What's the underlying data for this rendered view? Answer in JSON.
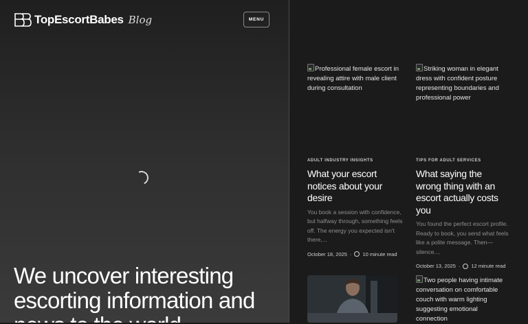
{
  "header": {
    "brand": "TopEscortBabes",
    "brand_suffix": "Blog",
    "menu_label": "MENU"
  },
  "hero": {
    "headline": "We uncover interesting escorting information and news to the world"
  },
  "posts": [
    {
      "image_alt": "Professional female escort in revealing attire with male client during consultation",
      "category": "ADULT INDUSTRY INSIGHTS",
      "title": "What your escort notices about your desire",
      "excerpt": "You book a session with confidence, but halfway through, something feels off. The energy you expected isn't there,...",
      "date": "October 18, 2025",
      "read_time": "10 minute read"
    },
    {
      "image_alt": "Striking woman in elegant dress with confident posture representing boundaries and professional power",
      "category": "TIPS FOR ADULT SERVICES",
      "title": "What saying the wrong thing with an escort actually costs you",
      "excerpt": "You found the perfect escort profile. Ready to book, you send what feels like a polite message. Then—silence....",
      "date": "October 13, 2025",
      "read_time": "12 minute read"
    },
    {
      "image_alt": "Two people having intimate conversation on comfortable couch with warm lighting suggesting emotional connection"
    }
  ]
}
